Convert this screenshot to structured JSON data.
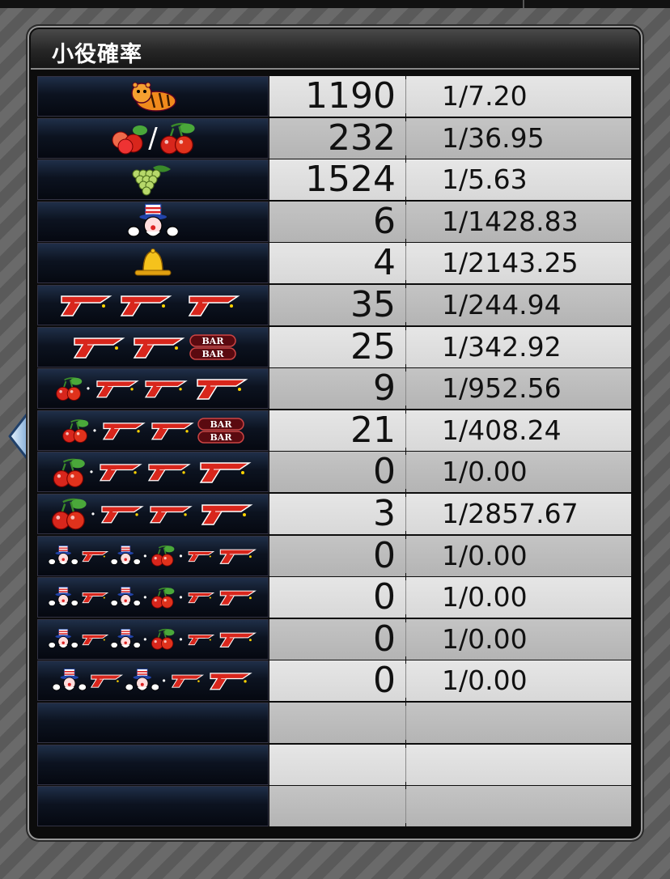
{
  "panel": {
    "title": "小役確率"
  },
  "colors": {
    "cell_light": "#e0e0e0",
    "cell_dark": "#bcbcbc",
    "icon_bg": "#0c1320",
    "seven_red": "#d8261c"
  },
  "rows": [
    {
      "icon": "tiger-icon",
      "count": "1190",
      "prob": "1/7.20"
    },
    {
      "icon": "peach-or-cherry-icon",
      "count": "232",
      "prob": "1/36.95"
    },
    {
      "icon": "grape-icon",
      "count": "1524",
      "prob": "1/5.63"
    },
    {
      "icon": "uncle-sam-icon",
      "count": "6",
      "prob": "1/1428.83"
    },
    {
      "icon": "bell-icon",
      "count": "4",
      "prob": "1/2143.25"
    },
    {
      "icon": "seven-seven-seven-icon",
      "count": "35",
      "prob": "1/244.94"
    },
    {
      "icon": "seven-seven-bar-icon",
      "count": "25",
      "prob": "1/342.92"
    },
    {
      "icon": "cherry-plus-seven-seven-seven-icon",
      "count": "9",
      "prob": "1/952.56"
    },
    {
      "icon": "cherry-plus-seven-seven-bar-icon",
      "count": "21",
      "prob": "1/408.24"
    },
    {
      "icon": "peach-plus-seven-seven-seven-icon",
      "count": "0",
      "prob": "1/0.00"
    },
    {
      "icon": "cherry-single-plus-seven-seven-seven-icon",
      "count": "3",
      "prob": "1/2857.67"
    },
    {
      "icon": "sam-seven-plus-cherry-plus-seven-icon",
      "count": "0",
      "prob": "1/0.00"
    },
    {
      "icon": "sam-seven-plus-cherry-plus-seven-icon",
      "count": "0",
      "prob": "1/0.00"
    },
    {
      "icon": "sam-seven-plus-cherry-plus-seven-icon",
      "count": "0",
      "prob": "1/0.00"
    },
    {
      "icon": "sam-seven-sam-plus-seven-icon",
      "count": "0",
      "prob": "1/0.00"
    },
    {
      "icon": "",
      "count": "",
      "prob": ""
    },
    {
      "icon": "",
      "count": "",
      "prob": ""
    },
    {
      "icon": "",
      "count": "",
      "prob": ""
    }
  ],
  "nav": {
    "prev_icon": "left-arrow-icon"
  }
}
